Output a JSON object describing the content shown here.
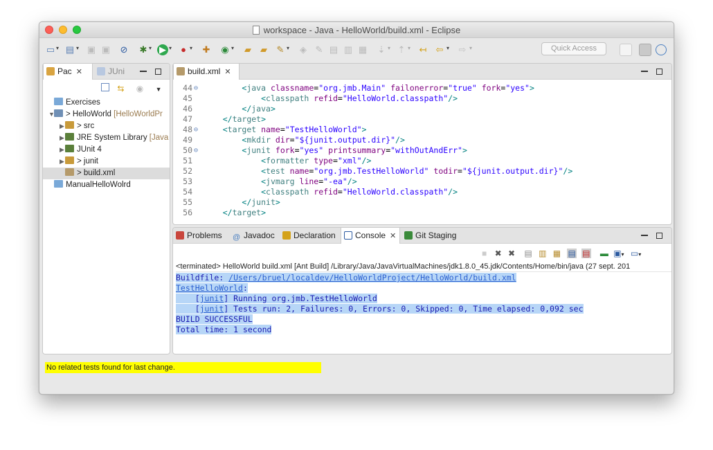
{
  "window": {
    "title": "workspace - Java - HelloWorld/build.xml - Eclipse"
  },
  "toolbar": {
    "quick_access_placeholder": "Quick Access"
  },
  "explorer": {
    "tabs": [
      {
        "label": "Pac",
        "active": true
      },
      {
        "label": "JUni",
        "active": false
      }
    ],
    "tree": [
      {
        "label": "Exercises",
        "indent": 0,
        "expander": "",
        "selected": false
      },
      {
        "label": "> HelloWorld",
        "suffix": "[HelloWorldPr",
        "indent": 0,
        "expander": "▼",
        "selected": false
      },
      {
        "label": "> src",
        "indent": 1,
        "expander": "▶",
        "selected": false
      },
      {
        "label": "JRE System Library",
        "suffix": "[Java",
        "indent": 1,
        "expander": "▶",
        "selected": false
      },
      {
        "label": "JUnit 4",
        "indent": 1,
        "expander": "▶",
        "selected": false
      },
      {
        "label": "> junit",
        "indent": 1,
        "expander": "▶",
        "selected": false
      },
      {
        "label": "> build.xml",
        "indent": 1,
        "expander": "",
        "selected": true
      },
      {
        "label": "ManualHelloWolrd",
        "indent": 0,
        "expander": "",
        "selected": false
      }
    ]
  },
  "editor": {
    "tab_label": "build.xml",
    "lines": [
      {
        "num": "44",
        "fold": "⊖",
        "indent": "    ",
        "text": "<java classname=\"org.jmb.Main\" failonerror=\"true\" fork=\"yes\">"
      },
      {
        "num": "45",
        "fold": "",
        "indent": "        ",
        "text": "<classpath refid=\"HelloWorld.classpath\"/>"
      },
      {
        "num": "46",
        "fold": "",
        "indent": "    ",
        "text": "</java>"
      },
      {
        "num": "47",
        "fold": "",
        "indent": "",
        "text": "</target>"
      },
      {
        "num": "48",
        "fold": "⊖",
        "indent": "",
        "text": "<target name=\"TestHelloWorld\">"
      },
      {
        "num": "49",
        "fold": "",
        "indent": "    ",
        "text": "<mkdir dir=\"${junit.output.dir}\"/>"
      },
      {
        "num": "50",
        "fold": "⊖",
        "indent": "    ",
        "text": "<junit fork=\"yes\" printsummary=\"withOutAndErr\">"
      },
      {
        "num": "51",
        "fold": "",
        "indent": "        ",
        "text": "<formatter type=\"xml\"/>"
      },
      {
        "num": "52",
        "fold": "",
        "indent": "        ",
        "text": "<test name=\"org.jmb.TestHelloWorld\" todir=\"${junit.output.dir}\"/>"
      },
      {
        "num": "53",
        "fold": "",
        "indent": "        ",
        "text": "<jvmarg line=\"-ea\"/>"
      },
      {
        "num": "54",
        "fold": "",
        "indent": "        ",
        "text": "<classpath refid=\"HelloWorld.classpath\"/>"
      },
      {
        "num": "55",
        "fold": "",
        "indent": "    ",
        "text": "</junit>"
      },
      {
        "num": "56",
        "fold": "",
        "indent": "",
        "text": "</target>"
      }
    ]
  },
  "bottom": {
    "tabs": [
      {
        "label": "Problems",
        "active": false
      },
      {
        "label": "Javadoc",
        "active": false
      },
      {
        "label": "Declaration",
        "active": false
      },
      {
        "label": "Console",
        "active": true
      },
      {
        "label": "Git Staging",
        "active": false
      }
    ],
    "terminated_line": "<terminated> HelloWorld build.xml [Ant Build] /Library/Java/JavaVirtualMachines/jdk1.8.0_45.jdk/Contents/Home/bin/java (27 sept. 201",
    "output": [
      {
        "prefix": "Buildfile: ",
        "link": "/Users/bruel/localdev/HelloWorldProject/HelloWorld/build.xml",
        "rest": ""
      },
      {
        "prefix": "",
        "link": "TestHelloWorld",
        "rest": ":"
      },
      {
        "prefix": "    [",
        "link": "junit",
        "rest": "] Running org.jmb.TestHelloWorld"
      },
      {
        "prefix": "    [",
        "link": "junit",
        "rest": "] Tests run: 2, Failures: 0, Errors: 0, Skipped: 0, Time elapsed: 0,092 sec"
      },
      {
        "prefix": "BUILD SUCCESSFUL",
        "link": "",
        "rest": ""
      },
      {
        "prefix": "Total time: 1 second",
        "link": "",
        "rest": ""
      }
    ]
  },
  "status": {
    "message": "No related tests found for last change."
  }
}
